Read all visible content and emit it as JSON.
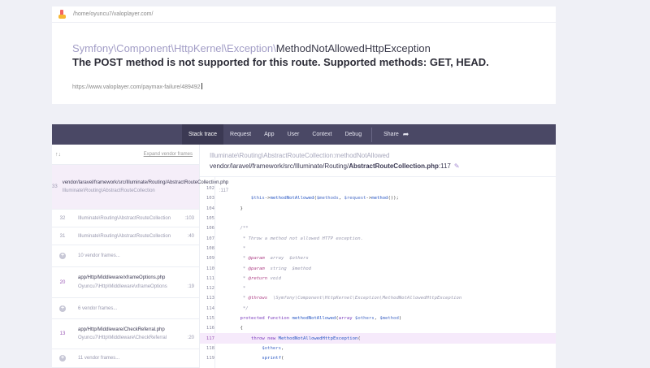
{
  "header": {
    "path": "/home/oyuncu7/valoplayer.com/",
    "exception_ns": "Symfony\\Component\\HttpKernel\\Exception\\",
    "exception_name": "MethodNotAllowedHttpException",
    "message": "The POST method is not supported for this route. Supported methods: GET, HEAD.",
    "url": "https://www.valoplayer.com/paymax-failure/489492"
  },
  "tabs": [
    {
      "label": "Stack trace",
      "active": true
    },
    {
      "label": "Request"
    },
    {
      "label": "App"
    },
    {
      "label": "User"
    },
    {
      "label": "Context"
    },
    {
      "label": "Debug"
    }
  ],
  "share_label": "Share",
  "frames_panel": {
    "sort_icons": "↑↓",
    "expand_label": "Expand vendor frames"
  },
  "frames": [
    {
      "index": "33",
      "file": "vendor/laravel/framework/src/Illuminate/Routing/",
      "file_bold": "AbstractRouteCollection.php",
      "class": "Illuminate\\Routing\\AbstractRouteCollection",
      "line": ":117"
    },
    {
      "index": "32",
      "class": "Illuminate\\Routing\\AbstractRouteCollection",
      "line": ":103"
    },
    {
      "index": "31",
      "class": "Illuminate\\Routing\\AbstractRouteCollection",
      "line": ":40"
    },
    {
      "vendor_label": "10 vendor frames..."
    },
    {
      "index": "20",
      "file": "app/Http/Middleware/",
      "file_bold": "xframeOptions.php",
      "class": "Oyuncu7\\Http\\Middleware\\xframeOptions",
      "line": ":19"
    },
    {
      "vendor_label": "6 vendor frames..."
    },
    {
      "index": "13",
      "file": "app/Http/Middleware/",
      "file_bold": "CheckReferral.php",
      "class": "Oyuncu7\\Http\\Middleware\\CheckReferral",
      "line": ":20"
    },
    {
      "vendor_label": "11 vendor frames..."
    }
  ],
  "code_header": {
    "fn_class": "Illuminate\\Routing\\AbstractRouteCollection",
    "fn_method": ":methodNotAllowed",
    "file_dir": "vendor/laravel/framework/src/Illuminate/Routing/",
    "file_name": "AbstractRouteCollection.php",
    "file_line": ":117"
  },
  "code_lines": [
    {
      "n": "102",
      "t": ""
    },
    {
      "n": "103",
      "t": "        $this->methodNotAllowed($methods, $request->method());"
    },
    {
      "n": "104",
      "t": "    }"
    },
    {
      "n": "105",
      "t": ""
    },
    {
      "n": "106",
      "t": "    /**"
    },
    {
      "n": "107",
      "t": "     * Throw a method not allowed HTTP exception."
    },
    {
      "n": "108",
      "t": "     *"
    },
    {
      "n": "109",
      "t": "     * @param  array  $others"
    },
    {
      "n": "110",
      "t": "     * @param  string  $method"
    },
    {
      "n": "111",
      "t": "     * @return void"
    },
    {
      "n": "112",
      "t": "     *"
    },
    {
      "n": "113",
      "t": "     * @throws  \\Symfony\\Component\\HttpKernel\\Exception\\MethodNotAllowedHttpException"
    },
    {
      "n": "114",
      "t": "     */"
    },
    {
      "n": "115",
      "t": "    protected function methodNotAllowed(array $others, $method)"
    },
    {
      "n": "116",
      "t": "    {"
    },
    {
      "n": "117",
      "t": "        throw new MethodNotAllowedHttpException(",
      "hl": true
    },
    {
      "n": "118",
      "t": "            $others,"
    },
    {
      "n": "119",
      "t": "            sprintf("
    }
  ],
  "colors": {
    "tabbar": "#4a4865",
    "accent": "#9b59b6",
    "highlight": "#f6eafb"
  }
}
